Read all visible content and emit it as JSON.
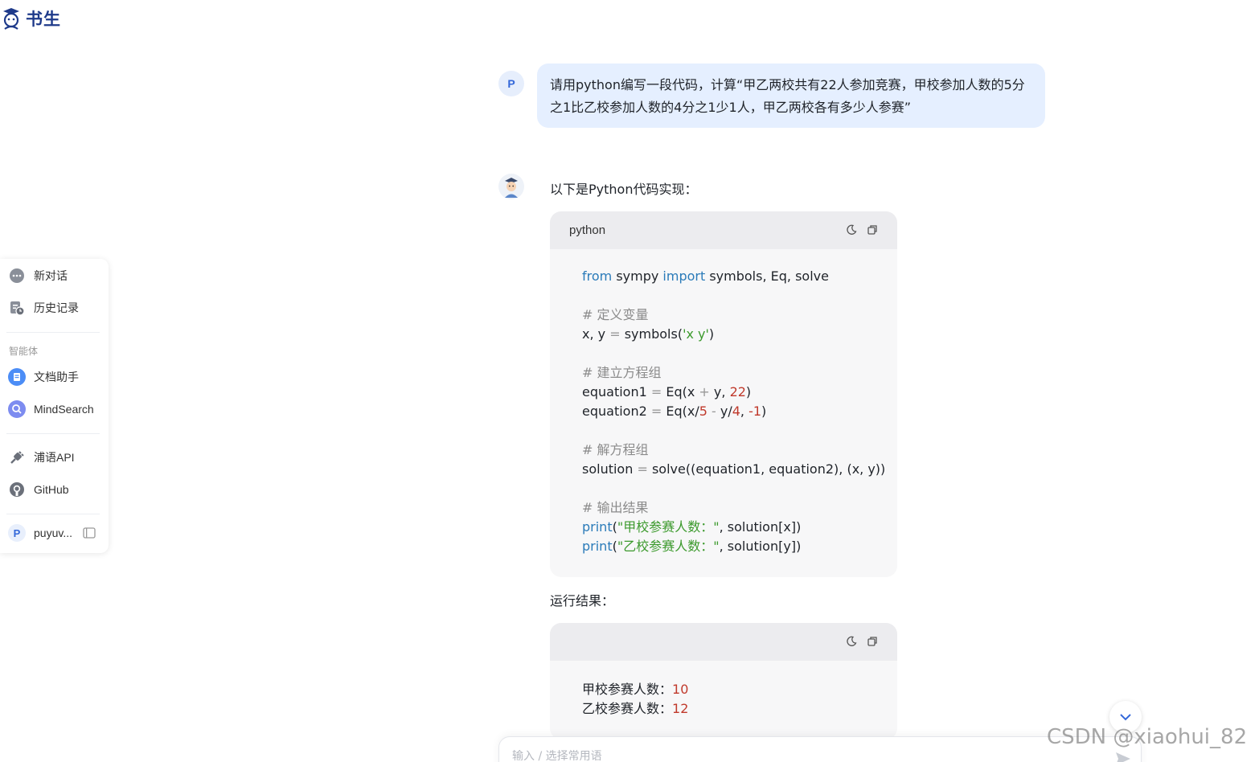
{
  "brand": {
    "name": "书生"
  },
  "sidebar": {
    "items": [
      {
        "label": "新对话",
        "icon": "chat-bubble-icon"
      },
      {
        "label": "历史记录",
        "icon": "history-icon"
      }
    ],
    "section_title": "智能体",
    "agents": [
      {
        "label": "文档助手",
        "icon": "document-assistant-icon"
      },
      {
        "label": "MindSearch",
        "icon": "mindsearch-icon"
      }
    ],
    "links": [
      {
        "label": "浦语API",
        "icon": "api-plug-icon"
      },
      {
        "label": "GitHub",
        "icon": "github-icon"
      }
    ],
    "user": {
      "avatar_letter": "P",
      "name": "puyuv..."
    }
  },
  "chat": {
    "user_avatar_letter": "P",
    "user_message_line1": "请用python编写一段代码，计算“甲乙两校共有22人参加竞赛，甲校参加人数的5分",
    "user_message_line2": "之1比乙校参加人数的4分之1少1人，甲乙两校各有多少人参赛”",
    "bot_intro": "以下是Python代码实现：",
    "code_block": {
      "language": "python",
      "lines": {
        "l1_from": "from",
        "l1_mod": " sympy ",
        "l1_import": "import",
        "l1_rest": " symbols, Eq, solve",
        "c1": "# 定义变量",
        "l3_a": "x, y ",
        "l3_eq": "=",
        "l3_b": " symbols(",
        "l3_str": "'x y'",
        "l3_c": ")",
        "c2": "# 建立方程组",
        "l5_a": "equation1 ",
        "l5_eq": "=",
        "l5_b": " Eq(x ",
        "l5_plus": "+",
        "l5_c": " y, ",
        "l5_num": "22",
        "l5_d": ")",
        "l6_a": "equation2 ",
        "l6_eq": "=",
        "l6_b": " Eq(x/",
        "l6_n1": "5",
        "l6_minus": " - ",
        "l6_c": "y/",
        "l6_n2": "4",
        "l6_d": ", ",
        "l6_n3": "-1",
        "l6_e": ")",
        "c3": "# 解方程组",
        "l8_a": "solution ",
        "l8_eq": "=",
        "l8_b": " solve((equation1, equation2), (x, y))",
        "c4": "# 输出结果",
        "l10_print": "print",
        "l10_a": "(",
        "l10_str": "\"甲校参赛人数：\"",
        "l10_b": ", solution[x])",
        "l11_print": "print",
        "l11_a": "(",
        "l11_str": "\"乙校参赛人数：\"",
        "l11_b": ", solution[y])"
      }
    },
    "result_label": "运行结果：",
    "result_block": {
      "row1_label": "甲校参赛人数：",
      "row1_value": "10",
      "row2_label": "乙校参赛人数：",
      "row2_value": "12"
    }
  },
  "input": {
    "placeholder": "输入 / 选择常用语"
  },
  "watermark": "CSDN @xiaohui_82",
  "colors": {
    "accent": "#3468d9",
    "user_bubble": "#e5efff",
    "brand": "#1e3a8a"
  }
}
